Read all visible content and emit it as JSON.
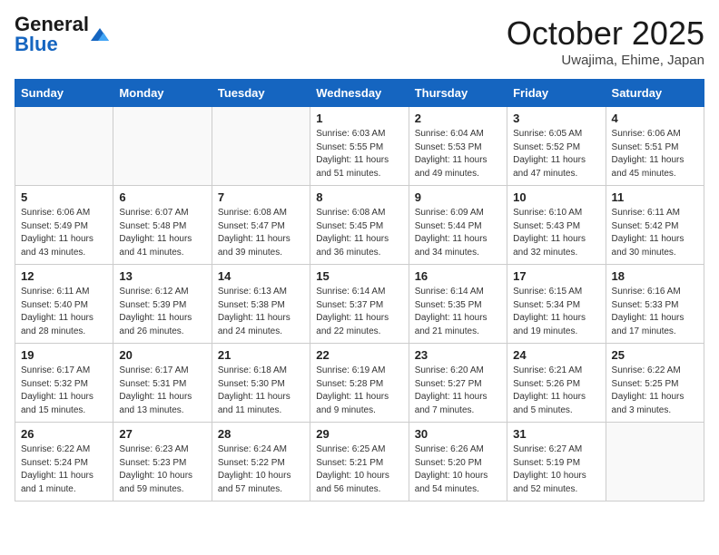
{
  "logo": {
    "general": "General",
    "blue": "Blue"
  },
  "title": "October 2025",
  "location": "Uwajima, Ehime, Japan",
  "weekdays": [
    "Sunday",
    "Monday",
    "Tuesday",
    "Wednesday",
    "Thursday",
    "Friday",
    "Saturday"
  ],
  "weeks": [
    [
      {
        "day": "",
        "info": ""
      },
      {
        "day": "",
        "info": ""
      },
      {
        "day": "",
        "info": ""
      },
      {
        "day": "1",
        "info": "Sunrise: 6:03 AM\nSunset: 5:55 PM\nDaylight: 11 hours\nand 51 minutes."
      },
      {
        "day": "2",
        "info": "Sunrise: 6:04 AM\nSunset: 5:53 PM\nDaylight: 11 hours\nand 49 minutes."
      },
      {
        "day": "3",
        "info": "Sunrise: 6:05 AM\nSunset: 5:52 PM\nDaylight: 11 hours\nand 47 minutes."
      },
      {
        "day": "4",
        "info": "Sunrise: 6:06 AM\nSunset: 5:51 PM\nDaylight: 11 hours\nand 45 minutes."
      }
    ],
    [
      {
        "day": "5",
        "info": "Sunrise: 6:06 AM\nSunset: 5:49 PM\nDaylight: 11 hours\nand 43 minutes."
      },
      {
        "day": "6",
        "info": "Sunrise: 6:07 AM\nSunset: 5:48 PM\nDaylight: 11 hours\nand 41 minutes."
      },
      {
        "day": "7",
        "info": "Sunrise: 6:08 AM\nSunset: 5:47 PM\nDaylight: 11 hours\nand 39 minutes."
      },
      {
        "day": "8",
        "info": "Sunrise: 6:08 AM\nSunset: 5:45 PM\nDaylight: 11 hours\nand 36 minutes."
      },
      {
        "day": "9",
        "info": "Sunrise: 6:09 AM\nSunset: 5:44 PM\nDaylight: 11 hours\nand 34 minutes."
      },
      {
        "day": "10",
        "info": "Sunrise: 6:10 AM\nSunset: 5:43 PM\nDaylight: 11 hours\nand 32 minutes."
      },
      {
        "day": "11",
        "info": "Sunrise: 6:11 AM\nSunset: 5:42 PM\nDaylight: 11 hours\nand 30 minutes."
      }
    ],
    [
      {
        "day": "12",
        "info": "Sunrise: 6:11 AM\nSunset: 5:40 PM\nDaylight: 11 hours\nand 28 minutes."
      },
      {
        "day": "13",
        "info": "Sunrise: 6:12 AM\nSunset: 5:39 PM\nDaylight: 11 hours\nand 26 minutes."
      },
      {
        "day": "14",
        "info": "Sunrise: 6:13 AM\nSunset: 5:38 PM\nDaylight: 11 hours\nand 24 minutes."
      },
      {
        "day": "15",
        "info": "Sunrise: 6:14 AM\nSunset: 5:37 PM\nDaylight: 11 hours\nand 22 minutes."
      },
      {
        "day": "16",
        "info": "Sunrise: 6:14 AM\nSunset: 5:35 PM\nDaylight: 11 hours\nand 21 minutes."
      },
      {
        "day": "17",
        "info": "Sunrise: 6:15 AM\nSunset: 5:34 PM\nDaylight: 11 hours\nand 19 minutes."
      },
      {
        "day": "18",
        "info": "Sunrise: 6:16 AM\nSunset: 5:33 PM\nDaylight: 11 hours\nand 17 minutes."
      }
    ],
    [
      {
        "day": "19",
        "info": "Sunrise: 6:17 AM\nSunset: 5:32 PM\nDaylight: 11 hours\nand 15 minutes."
      },
      {
        "day": "20",
        "info": "Sunrise: 6:17 AM\nSunset: 5:31 PM\nDaylight: 11 hours\nand 13 minutes."
      },
      {
        "day": "21",
        "info": "Sunrise: 6:18 AM\nSunset: 5:30 PM\nDaylight: 11 hours\nand 11 minutes."
      },
      {
        "day": "22",
        "info": "Sunrise: 6:19 AM\nSunset: 5:28 PM\nDaylight: 11 hours\nand 9 minutes."
      },
      {
        "day": "23",
        "info": "Sunrise: 6:20 AM\nSunset: 5:27 PM\nDaylight: 11 hours\nand 7 minutes."
      },
      {
        "day": "24",
        "info": "Sunrise: 6:21 AM\nSunset: 5:26 PM\nDaylight: 11 hours\nand 5 minutes."
      },
      {
        "day": "25",
        "info": "Sunrise: 6:22 AM\nSunset: 5:25 PM\nDaylight: 11 hours\nand 3 minutes."
      }
    ],
    [
      {
        "day": "26",
        "info": "Sunrise: 6:22 AM\nSunset: 5:24 PM\nDaylight: 11 hours\nand 1 minute."
      },
      {
        "day": "27",
        "info": "Sunrise: 6:23 AM\nSunset: 5:23 PM\nDaylight: 10 hours\nand 59 minutes."
      },
      {
        "day": "28",
        "info": "Sunrise: 6:24 AM\nSunset: 5:22 PM\nDaylight: 10 hours\nand 57 minutes."
      },
      {
        "day": "29",
        "info": "Sunrise: 6:25 AM\nSunset: 5:21 PM\nDaylight: 10 hours\nand 56 minutes."
      },
      {
        "day": "30",
        "info": "Sunrise: 6:26 AM\nSunset: 5:20 PM\nDaylight: 10 hours\nand 54 minutes."
      },
      {
        "day": "31",
        "info": "Sunrise: 6:27 AM\nSunset: 5:19 PM\nDaylight: 10 hours\nand 52 minutes."
      },
      {
        "day": "",
        "info": ""
      }
    ]
  ]
}
